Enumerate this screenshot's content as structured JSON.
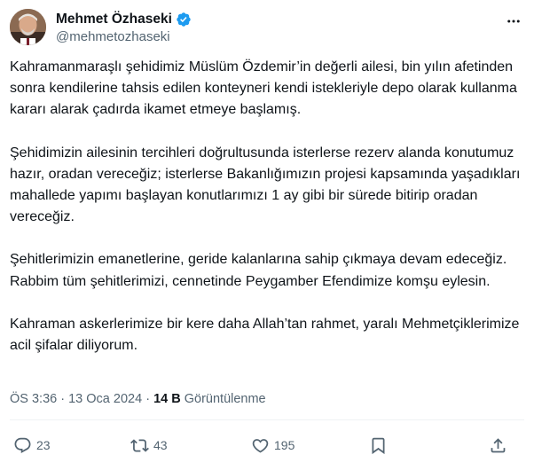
{
  "author": {
    "name": "Mehmet Özhaseki",
    "handle": "@mehmetozhaseki",
    "verified": true,
    "verified_color": "#1d9bf0"
  },
  "tweet": {
    "paragraphs": [
      "Kahramanmaraşlı şehidimiz Müslüm Özdemir’in değerli ailesi, bin yılın afetinden sonra kendilerine tahsis edilen konteyneri kendi istekleriyle depo olarak kullanma kararı alarak çadırda ikamet etmeye başlamış.",
      "Şehidimizin ailesinin tercihleri doğrultusunda isterlerse rezerv alanda konutumuz hazır, oradan vereceğiz; isterlerse Bakanlığımızın projesi kapsamında yaşadıkları mahallede yapımı başlayan konutlarımızı 1 ay gibi bir sürede bitirip oradan vereceğiz.",
      "Şehitlerimizin emanetlerine, geride kalanlarına sahip çıkmaya devam edeceğiz. Rabbim tüm şehitlerimizi, cennetinde Peygamber Efendimize komşu eylesin.",
      "Kahraman askerlerimize bir kere daha Allah’tan rahmet, yaralı Mehmetçiklerimize acil şifalar diliyorum."
    ]
  },
  "meta": {
    "time": "ÖS 3:36",
    "separator": "·",
    "date": "13 Oca 2024",
    "views_count": "14 B",
    "views_label": "Görüntülenme"
  },
  "actions": {
    "reply_count": "23",
    "retweet_count": "43",
    "like_count": "195",
    "icons": [
      "reply-icon",
      "retweet-icon",
      "like-icon",
      "bookmark-icon",
      "share-icon"
    ]
  }
}
